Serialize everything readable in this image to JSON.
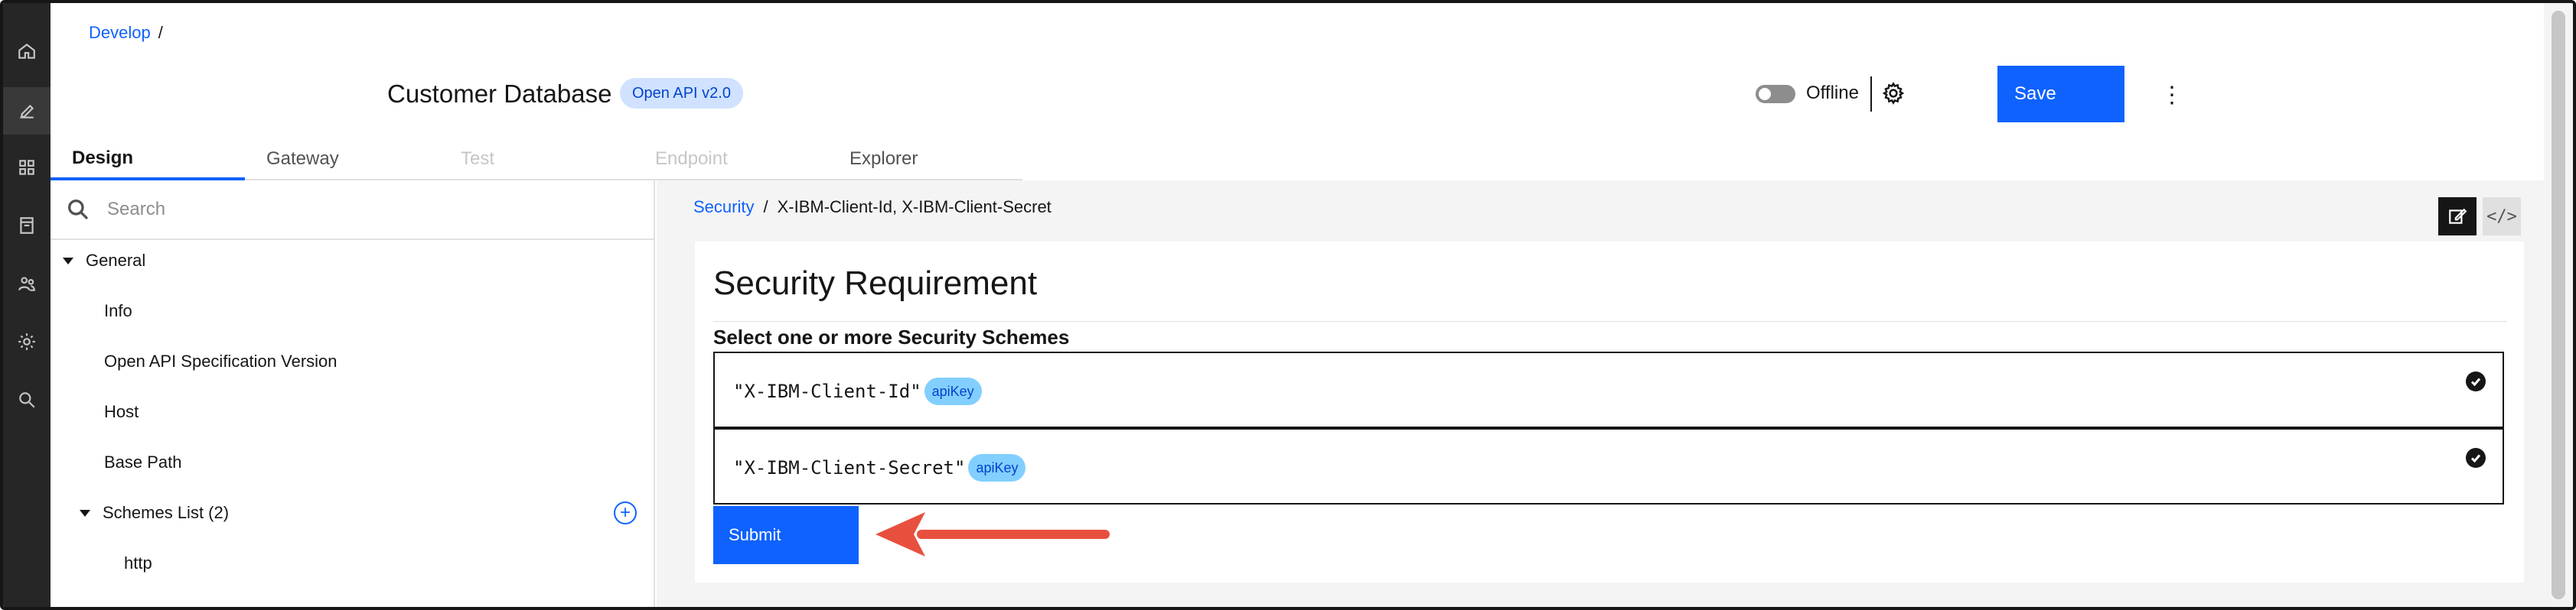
{
  "rail": {
    "items": [
      {
        "name": "home-icon"
      },
      {
        "name": "edit-icon",
        "active": true
      },
      {
        "name": "apps-icon"
      },
      {
        "name": "catalog-icon"
      },
      {
        "name": "users-icon"
      },
      {
        "name": "settings-icon"
      },
      {
        "name": "search-icon"
      }
    ]
  },
  "header": {
    "breadcrumb": {
      "link": "Develop",
      "separator": "/"
    },
    "title": "Customer Database",
    "badge": "Open API v2.0",
    "offline_label": "Offline",
    "save_label": "Save",
    "kebab": "⋮"
  },
  "tabs": [
    {
      "label": "Design",
      "state": "selected"
    },
    {
      "label": "Gateway",
      "state": "normal"
    },
    {
      "label": "Test",
      "state": "disabled"
    },
    {
      "label": "Endpoint",
      "state": "disabled"
    },
    {
      "label": "Explorer",
      "state": "normal"
    }
  ],
  "sidebar": {
    "search_placeholder": "Search",
    "items": [
      {
        "label": "General"
      },
      {
        "label": "Info"
      },
      {
        "label": "Open API Specification Version"
      },
      {
        "label": "Host"
      },
      {
        "label": "Base Path"
      },
      {
        "label": "Schemes List (2)"
      },
      {
        "label": "http"
      }
    ],
    "add_symbol": "+"
  },
  "main": {
    "breadcrumb": {
      "link": "Security",
      "separator": "/",
      "current": "X-IBM-Client-Id, X-IBM-Client-Secret"
    },
    "code_symbol": "</>",
    "panel": {
      "title": "Security Requirement",
      "subtitle": "Select one or more Security Schemes",
      "schemes": [
        {
          "name": "\"X-IBM-Client-Id\"",
          "type": "apiKey",
          "checked": true
        },
        {
          "name": "\"X-IBM-Client-Secret\"",
          "type": "apiKey",
          "checked": true
        }
      ],
      "submit_label": "Submit"
    }
  },
  "colors": {
    "accent": "#0f62fe",
    "rail_bg": "#262626",
    "arrow": "#e8503e"
  }
}
